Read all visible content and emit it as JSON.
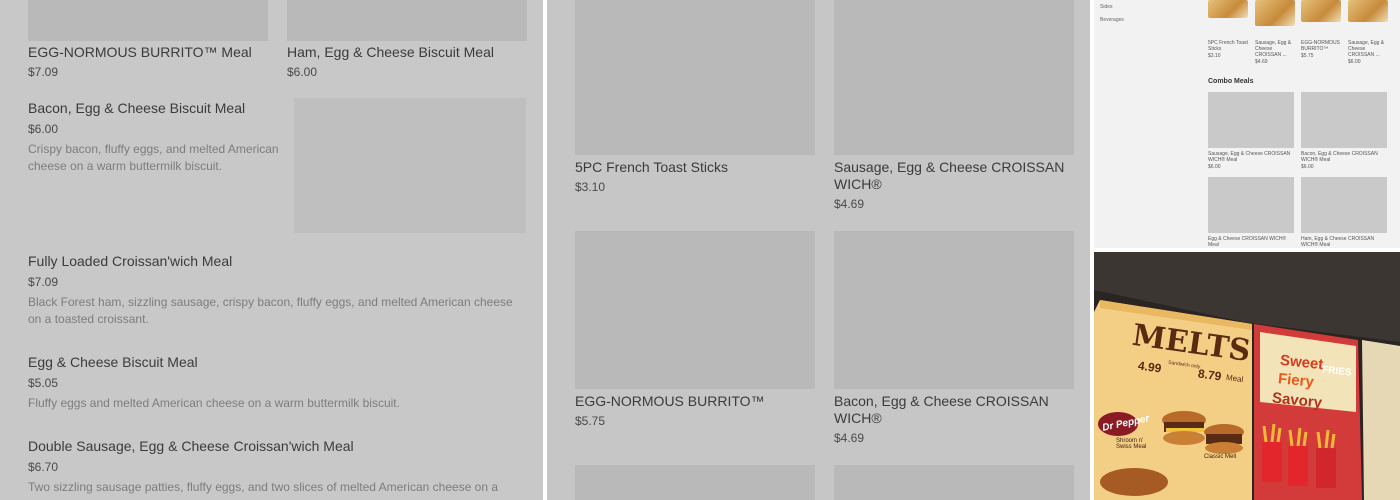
{
  "panel_left": {
    "items_top": [
      {
        "name": "EGG-NORMOUS BURRITO™ Meal",
        "price": "$7.09"
      },
      {
        "name": "Ham, Egg & Cheese Biscuit Meal",
        "price": "$6.00"
      }
    ],
    "items": [
      {
        "name": "Bacon, Egg & Cheese Biscuit Meal",
        "price": "$6.00",
        "desc": "Crispy bacon, fluffy eggs, and melted American cheese on a warm buttermilk biscuit."
      },
      {
        "name": "Fully Loaded Croissan'wich Meal",
        "price": "$7.09",
        "desc": "Black Forest ham, sizzling sausage, crispy bacon, fluffy eggs, and melted American cheese on a toasted croissant."
      },
      {
        "name": "Egg & Cheese Biscuit Meal",
        "price": "$5.05",
        "desc": "Fluffy eggs and melted American cheese on a warm buttermilk biscuit."
      },
      {
        "name": "Double Sausage, Egg & Cheese Croissan'wich Meal",
        "price": "$6.70",
        "desc": "Two sizzling sausage patties, fluffy eggs, and two slices of melted American cheese on a"
      }
    ]
  },
  "panel_middle": {
    "items": [
      {
        "name": "5PC French Toast Sticks",
        "price": "$3.10"
      },
      {
        "name": "Sausage, Egg & Cheese CROISSAN WICH®",
        "price": "$4.69"
      },
      {
        "name": "EGG-NORMOUS BURRITO™",
        "price": "$5.75"
      },
      {
        "name": "Bacon, Egg & Cheese CROISSAN WICH®",
        "price": "$4.69"
      }
    ]
  },
  "panel_small": {
    "sidebar": [
      "Sides",
      "Beverages"
    ],
    "top_items": [
      {
        "name": "5PC French Toast Sticks",
        "price": "$3.10"
      },
      {
        "name": "Sausage, Egg & Cheese CROISSAN ...",
        "price": "$4.69"
      },
      {
        "name": "EGG-NORMOUS BURRITO™",
        "price": "$5.75"
      },
      {
        "name": "Sausage, Egg & Cheese CROISSAN ...",
        "price": "$6.00"
      }
    ],
    "section_title": "Combo Meals",
    "combo_items": [
      {
        "name": "Sausage, Egg & Cheese CROISSAN WICH® Meal",
        "price": "$6.00"
      },
      {
        "name": "Bacon, Egg & Cheese CROISSAN WICH® Meal",
        "price": "$6.00"
      },
      {
        "name": "Egg & Cheese CROISSAN WICH® Meal",
        "price": ""
      },
      {
        "name": "Ham, Egg & Cheese CROISSAN WICH® Meal",
        "price": ""
      }
    ]
  },
  "panel_photo": {
    "board_title": "MELTS",
    "price_a": "4.99",
    "price_a_note": "Sandwich only",
    "price_b": "8.79",
    "price_b_note": "Meal",
    "brand": "Dr Pepper",
    "sweet_text": "Sweet",
    "fiery_text": "Fiery",
    "savory_text": "Savory",
    "fries_text": "FRIES",
    "item_a": "Shroom n' Swiss Meal",
    "item_b": "Classic Melt"
  }
}
